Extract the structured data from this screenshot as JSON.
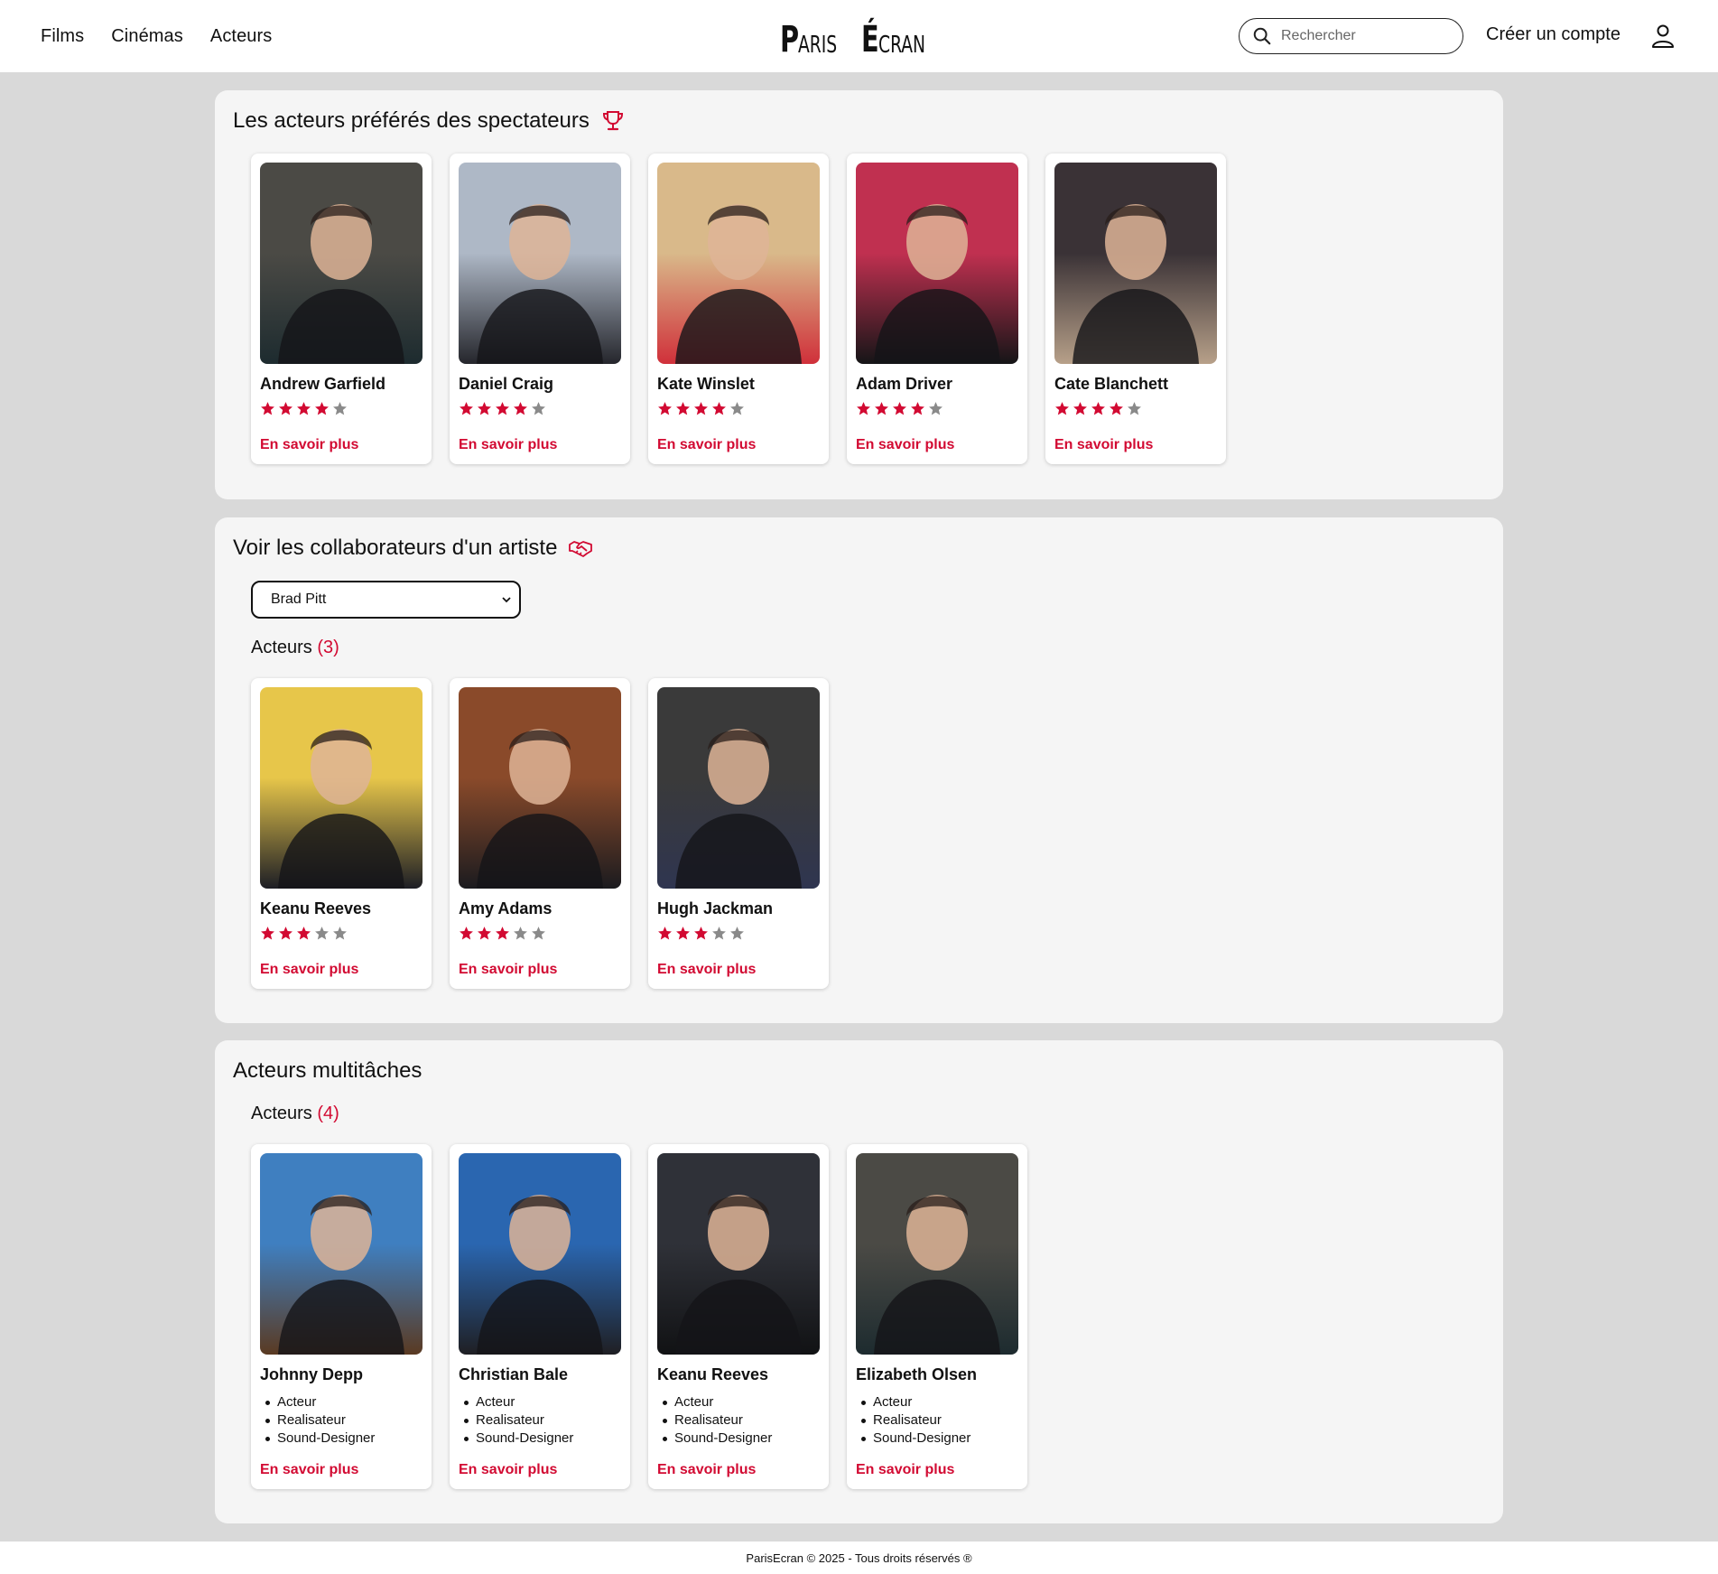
{
  "nav": {
    "films": "Films",
    "cinemas": "Cinémas",
    "acteurs": "Acteurs"
  },
  "logo": {
    "w1_big": "P",
    "w1_small": "ARIS",
    "w2_big": "É",
    "w2_small": "CRAN"
  },
  "search": {
    "placeholder": "Rechercher"
  },
  "header": {
    "signup": "Créer un compte"
  },
  "colors": {
    "accent": "#d20a32",
    "star_off": "#8a8a8a"
  },
  "favorites": {
    "title": "Les acteurs préférés des spectateurs",
    "icon": "trophy-icon",
    "actors": [
      {
        "name": "Andrew Garfield",
        "rating": 4,
        "link": "En savoir plus"
      },
      {
        "name": "Daniel Craig",
        "rating": 4,
        "link": "En savoir plus"
      },
      {
        "name": "Kate Winslet",
        "rating": 4,
        "link": "En savoir plus"
      },
      {
        "name": "Adam Driver",
        "rating": 4,
        "link": "En savoir plus"
      },
      {
        "name": "Cate Blanchett",
        "rating": 4,
        "link": "En savoir plus"
      }
    ]
  },
  "collaborators": {
    "title": "Voir les collaborateurs d'un artiste",
    "icon": "handshake-icon",
    "selected": "Brad Pitt",
    "subhead": "Acteurs",
    "count": "(3)",
    "actors": [
      {
        "name": "Keanu Reeves",
        "rating": 3,
        "link": "En savoir plus"
      },
      {
        "name": "Amy Adams",
        "rating": 3,
        "link": "En savoir plus"
      },
      {
        "name": "Hugh Jackman",
        "rating": 3,
        "link": "En savoir plus"
      }
    ]
  },
  "multitask": {
    "title": "Acteurs multitâches",
    "subhead": "Acteurs",
    "count": "(4)",
    "actors": [
      {
        "name": "Johnny Depp",
        "roles": [
          "Acteur",
          "Realisateur",
          "Sound-Designer"
        ],
        "link": "En savoir plus"
      },
      {
        "name": "Christian Bale",
        "roles": [
          "Acteur",
          "Realisateur",
          "Sound-Designer"
        ],
        "link": "En savoir plus"
      },
      {
        "name": "Keanu Reeves",
        "roles": [
          "Acteur",
          "Realisateur",
          "Sound-Designer"
        ],
        "link": "En savoir plus"
      },
      {
        "name": "Elizabeth Olsen",
        "roles": [
          "Acteur",
          "Realisateur",
          "Sound-Designer"
        ],
        "link": "En savoir plus"
      }
    ]
  },
  "footer": {
    "text": "ParisEcran © 2025 - Tous droits réservés ®"
  }
}
